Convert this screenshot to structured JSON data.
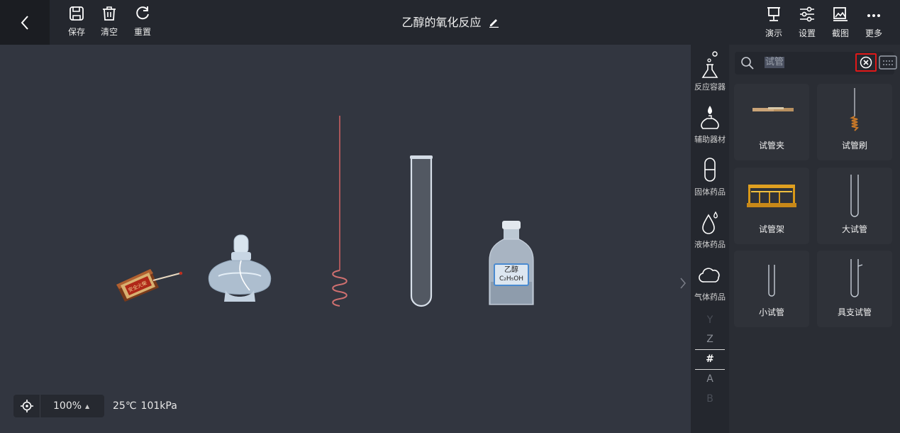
{
  "toolbar": {
    "save_label": "保存",
    "clear_label": "清空",
    "reset_label": "重置",
    "demo_label": "演示",
    "settings_label": "设置",
    "screenshot_label": "截图",
    "more_label": "更多"
  },
  "document": {
    "title": "乙醇的氧化反应"
  },
  "workspace": {
    "apparatus": [
      {
        "name": "matchbox",
        "label": "安全火柴"
      },
      {
        "name": "alcohol-lamp"
      },
      {
        "name": "copper-wire"
      },
      {
        "name": "test-tube"
      },
      {
        "name": "reagent-bottle",
        "label_line1": "乙醇",
        "label_line2": "C₂H₅OH"
      }
    ]
  },
  "status": {
    "zoom": "100%",
    "temperature": "25℃",
    "pressure": "101kPa"
  },
  "categories": [
    {
      "label": "反应容器",
      "icon": "flask-icon"
    },
    {
      "label": "辅助器材",
      "icon": "lamp-icon"
    },
    {
      "label": "固体药品",
      "icon": "capsule-icon"
    },
    {
      "label": "液体药品",
      "icon": "droplet-icon"
    },
    {
      "label": "气体药品",
      "icon": "cloud-icon"
    }
  ],
  "alphabet": [
    "Y",
    "Z",
    "#",
    "A",
    "B"
  ],
  "alphabet_active": "#",
  "search": {
    "query": "试管"
  },
  "items": [
    {
      "label": "试管夹",
      "icon": "test-tube-clamp-icon"
    },
    {
      "label": "试管刷",
      "icon": "test-tube-brush-icon"
    },
    {
      "label": "试管架",
      "icon": "test-tube-rack-icon"
    },
    {
      "label": "大试管",
      "icon": "large-test-tube-icon"
    },
    {
      "label": "小试管",
      "icon": "small-test-tube-icon"
    },
    {
      "label": "具支试管",
      "icon": "side-arm-test-tube-icon"
    }
  ],
  "colors": {
    "topbar": "#24272e",
    "canvas": "#323640",
    "panel": "#2a2d34",
    "highlight_border": "#e01818",
    "rack_wood": "#e0a020"
  }
}
